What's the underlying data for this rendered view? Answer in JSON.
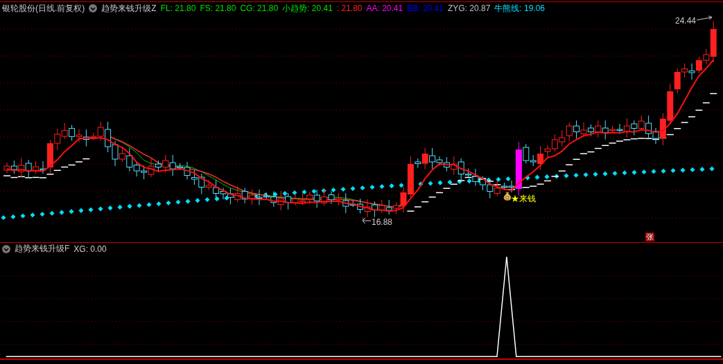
{
  "main_panel": {
    "stock": "银轮股份(日线.前复权)",
    "indicator_name": "趋势来钱升级Z",
    "values": [
      {
        "text": "FL: 21.80",
        "color": "#00e000"
      },
      {
        "text": "FS: 21.80",
        "color": "#00e000"
      },
      {
        "text": "CG: 21.80",
        "color": "#00e000"
      },
      {
        "text": "小趋势: 20.41",
        "color": "#00e000"
      },
      {
        "text": ": 21.80",
        "color": "#ff2020"
      },
      {
        "text": "AA: 20.41",
        "color": "#ff00ff"
      },
      {
        "text": "BB: 20.41",
        "color": "#0000ff"
      },
      {
        "text": "ZYG: 20.87",
        "color": "#c0c0c0"
      },
      {
        "text": "牛熊线: 19.06",
        "color": "#00e0ff"
      }
    ],
    "high_label": "24.44",
    "low_label": "16.88",
    "signal_label": "★来钱",
    "badge": "张"
  },
  "sub_panel": {
    "indicator_name": "趋势来钱升级F",
    "values": [
      {
        "text": "XG: 0.00",
        "color": "#d0d0d0"
      }
    ]
  }
}
